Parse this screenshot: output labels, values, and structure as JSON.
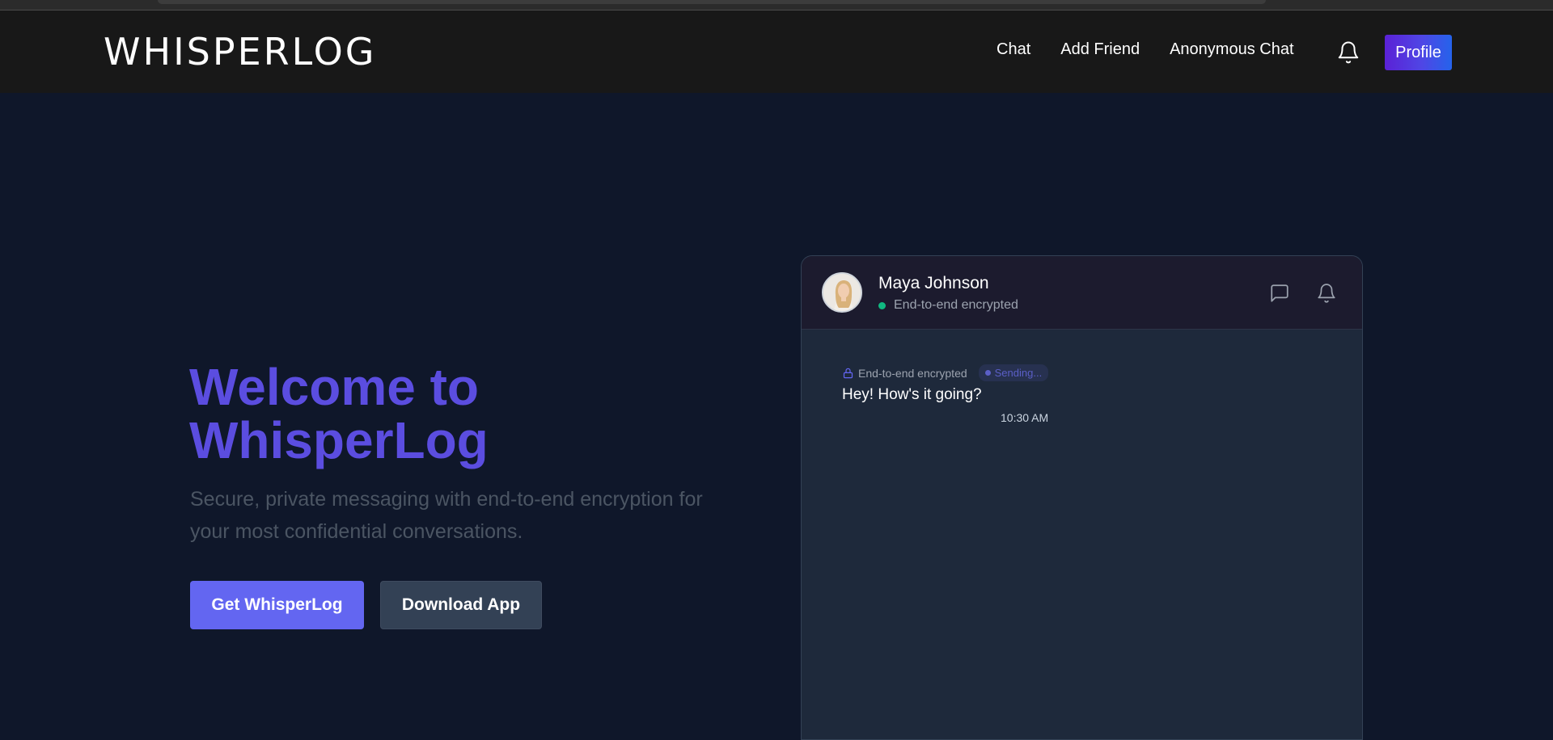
{
  "navbar": {
    "logo": "WHISPERLOG",
    "links": [
      "Chat",
      "Add Friend",
      "Anonymous Chat"
    ],
    "notification_icon": "bell-icon",
    "profile_label": "Profile"
  },
  "hero": {
    "title": "Welcome to WhisperLog",
    "subtitle": "Secure, private messaging with end-to-end encryption for your most confidential conversations.",
    "primary_button": "Get WhisperLog",
    "secondary_button": "Download App"
  },
  "chat_preview": {
    "contact_name": "Maya Johnson",
    "status": "End-to-end encrypted",
    "header_icons": [
      "message-square-icon",
      "bell-icon"
    ],
    "message": {
      "encryption_label": "End-to-end encrypted",
      "state": "Sending...",
      "text": "Hey! How's it going?",
      "time": "10:30 AM"
    }
  },
  "colors": {
    "page_bg": "#0f172a",
    "navbar_bg": "#181818",
    "accent": "#6366f1",
    "title": "#5b4de0",
    "online": "#10b981"
  }
}
